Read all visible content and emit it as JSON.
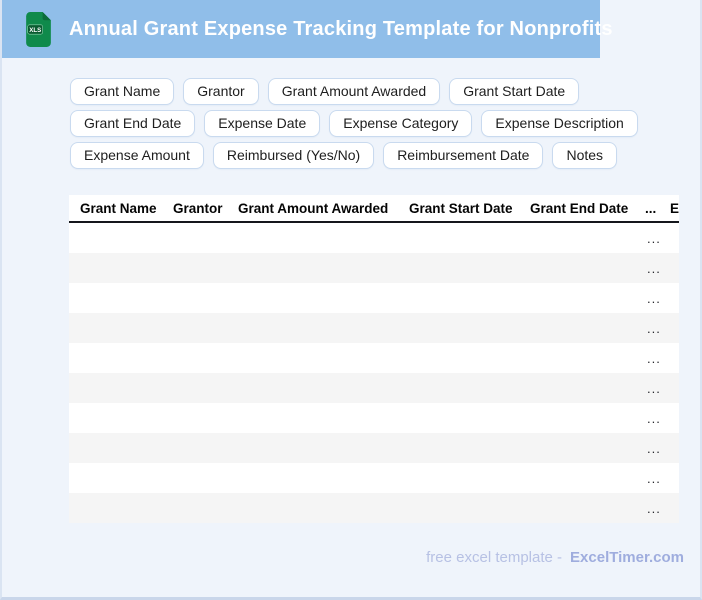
{
  "header": {
    "title": "Annual Grant Expense Tracking Template for Nonprofits",
    "file_icon_label": "XLS"
  },
  "field_chips": [
    "Grant Name",
    "Grantor",
    "Grant Amount Awarded",
    "Grant Start Date",
    "Grant End Date",
    "Expense Date",
    "Expense Category",
    "Expense Description",
    "Expense Amount",
    "Reimbursed (Yes/No)",
    "Reimbursement Date",
    "Notes"
  ],
  "table": {
    "columns": [
      "Grant Name",
      "Grantor",
      "Grant Amount Awarded",
      "Grant Start Date",
      "Grant End Date",
      "...",
      "E"
    ],
    "row_count": 10,
    "row_placeholder": "..."
  },
  "footer": {
    "prefix": "free excel template -",
    "brand": "ExcelTimer.com"
  },
  "colors": {
    "header_bar": "#90BEE9",
    "page_background": "#EFF4FB",
    "chip_border": "#C9DAEF",
    "row_alternate": "#F5F5F5",
    "icon_green_body": "#0F8A4B",
    "icon_green_fold": "#0B6B3A",
    "icon_green_badge": "#0A5C31",
    "footer_text": "#B7C1E4",
    "footer_brand": "#9FADDE"
  }
}
